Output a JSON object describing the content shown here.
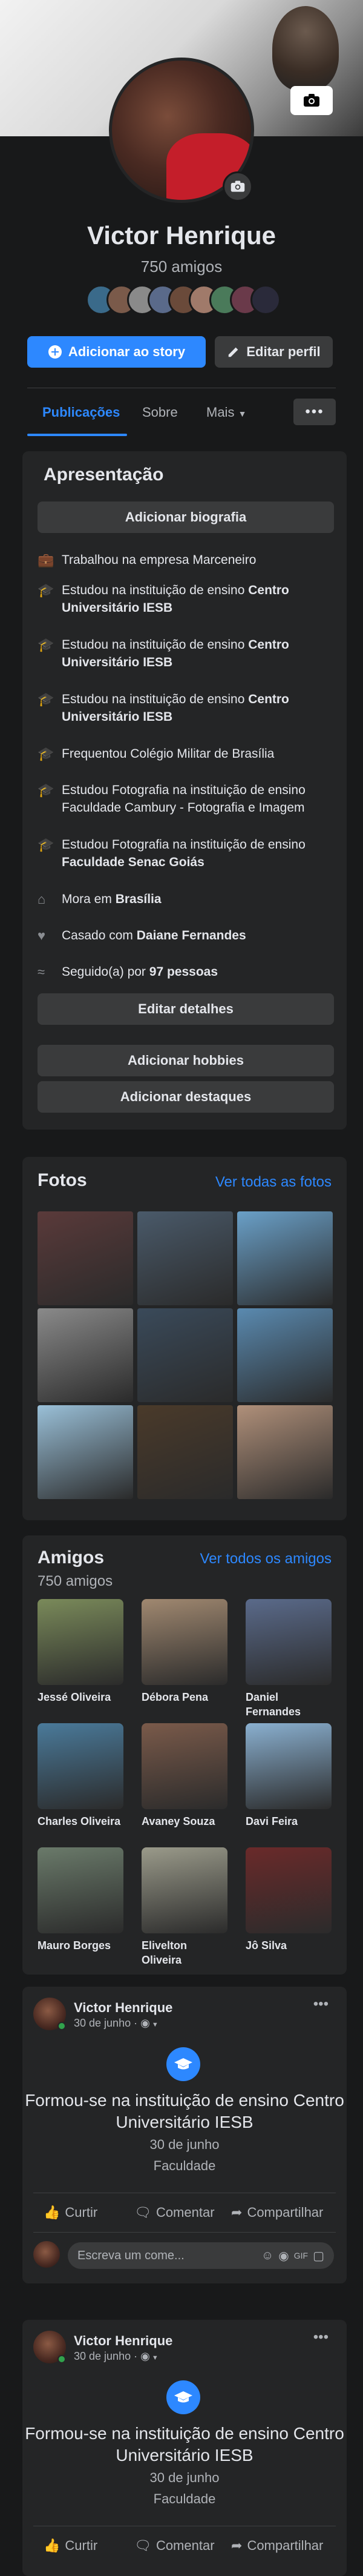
{
  "profile": {
    "name": "Victor Henrique",
    "friends_count": "750 amigos",
    "add_story": "Adicionar ao story",
    "edit_profile": "Editar perfil"
  },
  "tabs": [
    {
      "label": "Publicações",
      "active": true
    },
    {
      "label": "Sobre",
      "active": false
    },
    {
      "label": "Mais",
      "active": false
    }
  ],
  "intro": {
    "title": "Apresentação",
    "add_bio": "Adicionar biografia",
    "items": [
      {
        "icon": "briefcase-icon",
        "text": "Trabalhou na empresa Marceneiro"
      },
      {
        "icon": "graduation-cap-icon",
        "pre": "Estudou na instituição de ensino ",
        "bold": "Centro Universitário IESB"
      },
      {
        "icon": "graduation-cap-icon",
        "pre": "Estudou na instituição de ensino ",
        "bold": "Centro Universitário IESB"
      },
      {
        "icon": "graduation-cap-icon",
        "pre": "Estudou na instituição de ensino ",
        "bold": "Centro Universitário IESB"
      },
      {
        "icon": "graduation-cap-icon",
        "text": "Frequentou Colégio Militar de Brasília"
      },
      {
        "icon": "graduation-cap-icon",
        "pre": "Estudou Fotografia na instituição de ensino ",
        "text2": "Faculdade Cambury - Fotografia e Imagem"
      },
      {
        "icon": "graduation-cap-icon",
        "pre": "Estudou Fotografia na instituição de ensino ",
        "bold": "Faculdade Senac Goiás"
      },
      {
        "icon": "home-icon",
        "pre": "Mora em ",
        "bold": "Brasília"
      },
      {
        "icon": "heart-icon",
        "pre": "Casado com ",
        "bold": "Daiane Fernandes"
      },
      {
        "icon": "rss-icon",
        "pre": "Seguido(a) por ",
        "bold": "97 pessoas"
      }
    ],
    "edit_details": "Editar detalhes",
    "add_hobbies": "Adicionar hobbies",
    "add_highlights": "Adicionar destaques"
  },
  "photos": {
    "title": "Fotos",
    "see_all": "Ver todas as fotos",
    "colors": [
      "#5a3a3a",
      "#4a5a6a",
      "#6aa0c8",
      "#8a8a8a",
      "#3a4a5a",
      "#5a8ab0",
      "#9ac0d8",
      "#4a3a2a",
      "#b0907a"
    ]
  },
  "friends": {
    "title": "Amigos",
    "see_all": "Ver todos os amigos",
    "count": "750 amigos",
    "list": [
      {
        "name": "Jessé Oliveira",
        "color": "#7a8a5a"
      },
      {
        "name": "Débora Pena",
        "color": "#a08870"
      },
      {
        "name": "Daniel Fernandes",
        "color": "#5a6a8a"
      },
      {
        "name": "Charles Oliveira",
        "color": "#4a7a9a"
      },
      {
        "name": "Avaney Souza",
        "color": "#7a5a4a"
      },
      {
        "name": "Davi Feira",
        "color": "#8ab0d0"
      },
      {
        "name": "Mauro Borges",
        "color": "#6a7a6a"
      },
      {
        "name": "Elivelton Oliveira",
        "color": "#9a9a8a"
      },
      {
        "name": "Jô Silva",
        "color": "#6a2a2a"
      }
    ]
  },
  "posts": [
    {
      "author": "Victor Henrique",
      "date": "30 de junho · ",
      "title": "Formou-se na instituição de ensino Centro Universitário IESB",
      "date_line": "30 de junho",
      "category": "Faculdade"
    },
    {
      "author": "Victor Henrique",
      "date": "30 de junho · ",
      "title": "Formou-se na instituição de ensino Centro Universitário IESB",
      "date_line": "30 de junho",
      "category": "Faculdade"
    }
  ],
  "actions": {
    "like": "Curtir",
    "comment": "Comentar",
    "share": "Compartilhar",
    "comment_placeholder": "Escreva um come..."
  }
}
